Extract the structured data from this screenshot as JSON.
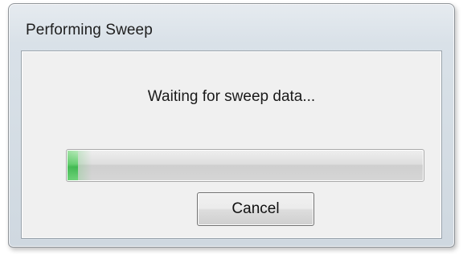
{
  "dialog": {
    "title": "Performing Sweep",
    "status_text": "Waiting for sweep data...",
    "progress_fraction": 0.03,
    "cancel_label": "Cancel"
  }
}
